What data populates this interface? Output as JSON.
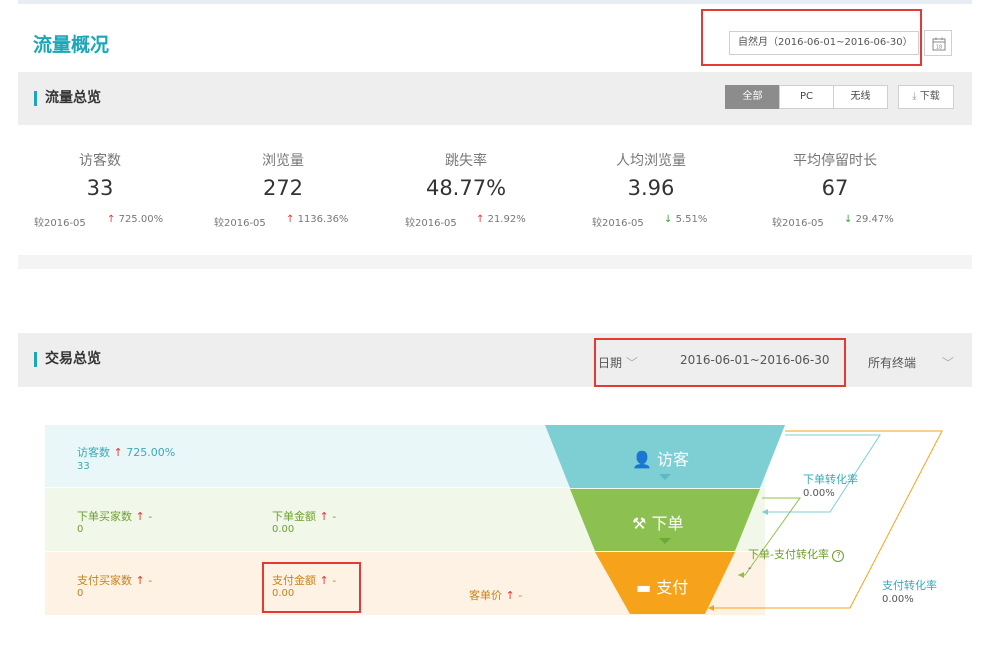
{
  "page": {
    "title": "流量概况"
  },
  "date_picker": {
    "value": "自然月（2016-06-01~2016-06-30）"
  },
  "traffic_overview": {
    "title": "流量总览",
    "segments": [
      "全部",
      "PC",
      "无线"
    ],
    "active_segment": "全部",
    "download_label": "下载",
    "metrics": [
      {
        "label": "访客数",
        "value": "33",
        "compare": "较2016-05",
        "change": "725.00%",
        "direction": "up"
      },
      {
        "label": "浏览量",
        "value": "272",
        "compare": "较2016-05",
        "change": "1136.36%",
        "direction": "up"
      },
      {
        "label": "跳失率",
        "value": "48.77%",
        "compare": "较2016-05",
        "change": "21.92%",
        "direction": "up"
      },
      {
        "label": "人均浏览量",
        "value": "3.96",
        "compare": "较2016-05",
        "change": "5.51%",
        "direction": "down"
      },
      {
        "label": "平均停留时长",
        "value": "67",
        "compare": "较2016-05",
        "change": "29.47%",
        "direction": "down"
      }
    ]
  },
  "trade_overview": {
    "title": "交易总览",
    "date_label": "日期",
    "date_range": "2016-06-01~2016-06-30",
    "terminal": "所有终端",
    "visitors": {
      "label": "访客数",
      "change": "725.00%",
      "value": "33"
    },
    "order_buyers": {
      "label": "下单买家数",
      "change": "-",
      "value": "0"
    },
    "order_amount": {
      "label": "下单金额",
      "change": "-",
      "value": "0.00"
    },
    "pay_buyers": {
      "label": "支付买家数",
      "change": "-",
      "value": "0"
    },
    "pay_amount": {
      "label": "支付金额",
      "change": "-",
      "value": "0.00"
    },
    "avg_order_value": {
      "label": "客单价",
      "change": "-"
    },
    "funnel": {
      "visit": "访客",
      "order": "下单",
      "pay": "支付"
    },
    "conversions": {
      "order_rate": {
        "label": "下单转化率",
        "value": "0.00%"
      },
      "order_pay_rate": {
        "label": "下单-支付转化率",
        "value": "-"
      },
      "pay_rate": {
        "label": "支付转化率",
        "value": "0.00%"
      }
    }
  },
  "colors": {
    "accent": "#1aa7b8",
    "up": "#e53935",
    "down": "#3aa33a",
    "funnel_visit": "#7ecfd3",
    "funnel_order": "#8cc152",
    "funnel_pay": "#f7a21b",
    "highlight_box": "#e53935"
  }
}
